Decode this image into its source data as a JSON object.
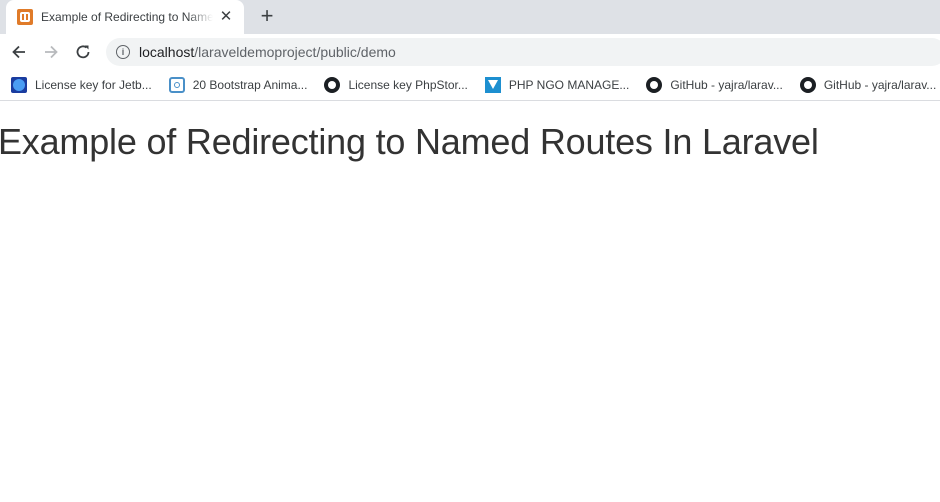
{
  "browser": {
    "tab": {
      "title": "Example of Redirecting to Named Routes In Laravel",
      "favicon": "xampp-icon",
      "close_glyph": "✕"
    },
    "new_tab_glyph": "+",
    "address": {
      "host": "localhost",
      "path": "/laraveldemoproject/public/demo"
    },
    "bookmarks": [
      {
        "label": "License key for Jetb...",
        "icon": "jetbrains-icon"
      },
      {
        "label": "20 Bootstrap Anima...",
        "icon": "bootstrap-icon"
      },
      {
        "label": "License key PhpStor...",
        "icon": "github-icon"
      },
      {
        "label": "PHP NGO MANAGE...",
        "icon": "ngo-icon"
      },
      {
        "label": "GitHub - yajra/larav...",
        "icon": "github-icon"
      },
      {
        "label": "GitHub - yajra/larav...",
        "icon": "github-icon"
      }
    ]
  },
  "page": {
    "heading": "Example of Redirecting to Named Routes In Laravel"
  },
  "colors": {
    "tabstrip": "#dee1e6",
    "heading": "#333333",
    "favicon": "#e07b29"
  }
}
